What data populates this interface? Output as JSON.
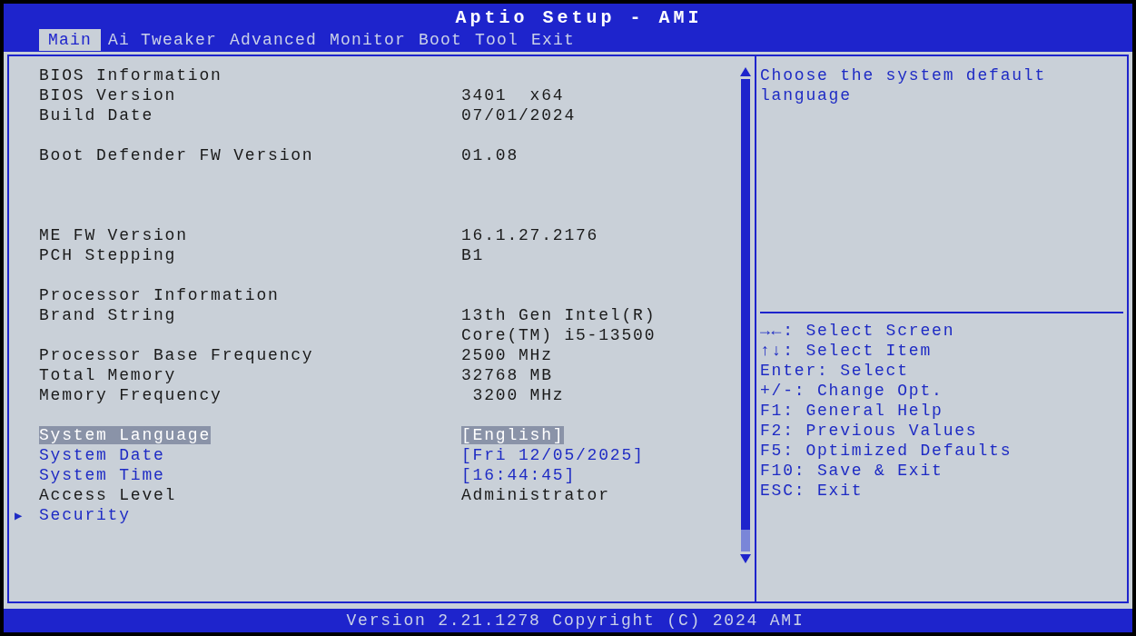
{
  "window": {
    "title": "Aptio Setup - AMI"
  },
  "tabs": [
    {
      "label": "Main",
      "selected": true
    },
    {
      "label": "Ai Tweaker",
      "selected": false
    },
    {
      "label": "Advanced",
      "selected": false
    },
    {
      "label": "Monitor",
      "selected": false
    },
    {
      "label": "Boot",
      "selected": false
    },
    {
      "label": "Tool",
      "selected": false
    },
    {
      "label": "Exit",
      "selected": false
    }
  ],
  "groups": [
    [
      {
        "kind": "info",
        "label": "BIOS Information"
      },
      {
        "kind": "info",
        "label": "BIOS Version",
        "value": "3401  x64"
      },
      {
        "kind": "info",
        "label": "Build Date",
        "value": "07/01/2024"
      }
    ],
    [
      {
        "kind": "info",
        "label": "Boot Defender FW Version",
        "value": "01.08"
      }
    ],
    [
      {
        "kind": "info",
        "label": "ME FW Version",
        "value": "16.1.27.2176"
      },
      {
        "kind": "info",
        "label": "PCH Stepping",
        "value": "B1"
      }
    ],
    [
      {
        "kind": "info",
        "label": "Processor Information"
      },
      {
        "kind": "info",
        "label": "Brand String",
        "value": "13th Gen Intel(R) Core(TM) i5-13500"
      },
      {
        "kind": "info",
        "label": "Processor Base Frequency",
        "value": "2500 MHz"
      },
      {
        "kind": "info",
        "label": "Total Memory",
        "value": "32768 MB"
      },
      {
        "kind": "info",
        "label": "Memory Frequency",
        "value": " 3200 MHz"
      }
    ],
    [
      {
        "kind": "setting",
        "label": "System Language",
        "value": "[English]",
        "selected": true
      },
      {
        "kind": "setting",
        "label": "System Date",
        "value": "[Fri 12/05/2025]",
        "selected": false
      },
      {
        "kind": "setting",
        "label": "System Time",
        "value": "[16:44:45]",
        "selected": false
      },
      {
        "kind": "info",
        "label": "Access Level",
        "value": "Administrator"
      },
      {
        "kind": "submenu",
        "marker": "▶",
        "label": "Security",
        "selected": false
      }
    ]
  ],
  "help_text": "Choose the system default language",
  "key_help": [
    "→←: Select Screen",
    "↑↓: Select Item",
    "Enter: Select",
    "+/-: Change Opt.",
    "F1: General Help",
    "F2: Previous Values",
    "F5: Optimized Defaults",
    "F10: Save & Exit",
    "ESC: Exit"
  ],
  "status_bar": "Version 2.21.1278 Copyright (C) 2024 AMI"
}
